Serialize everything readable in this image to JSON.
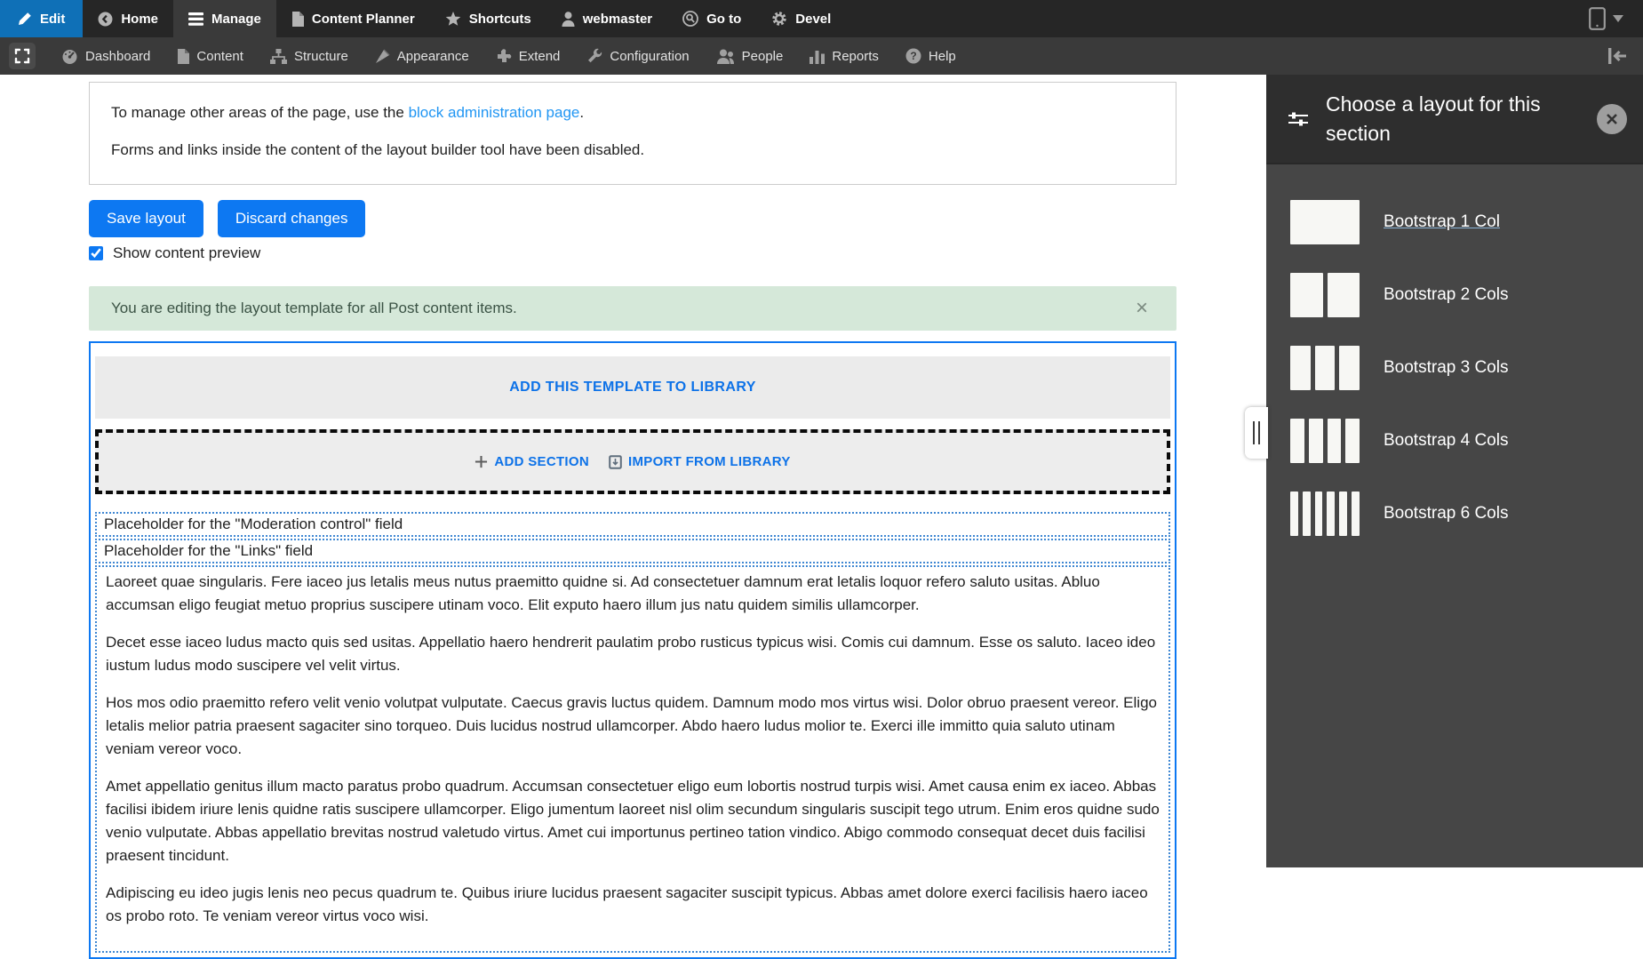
{
  "colors": {
    "toolbar_bg": "#262626",
    "toolbar_active_blue": "#0f70b7",
    "tray_bg": "#3a3a3a",
    "button_blue": "#0d78f2",
    "link_blue": "#2196f3",
    "builder_link_blue": "#0d72e8",
    "dotted_outline_blue": "#3f87d2",
    "alert_bg": "#d5e8d9",
    "alert_text": "#3a5244",
    "sidebar_bg": "#464646",
    "sidebar_header_bg": "#2e2e2e"
  },
  "toolbar_primary": {
    "items": [
      {
        "label": "Edit",
        "icon": "pencil-icon"
      },
      {
        "label": "Home",
        "icon": "back-circle-icon"
      },
      {
        "label": "Manage",
        "icon": "hamburger-icon"
      },
      {
        "label": "Content Planner",
        "icon": "file-icon"
      },
      {
        "label": "Shortcuts",
        "icon": "star-icon"
      },
      {
        "label": "webmaster",
        "icon": "user-icon"
      },
      {
        "label": "Go to",
        "icon": "search-circle-icon"
      },
      {
        "label": "Devel",
        "icon": "gear-icon"
      }
    ],
    "device_preview": {
      "icon": "mobile-device-icon",
      "caret": "caret-down-icon"
    }
  },
  "toolbar_secondary": {
    "items": [
      {
        "label": "Dashboard",
        "icon": "gauge-icon"
      },
      {
        "label": "Content",
        "icon": "file-icon"
      },
      {
        "label": "Structure",
        "icon": "sitemap-icon"
      },
      {
        "label": "Appearance",
        "icon": "brush-icon"
      },
      {
        "label": "Extend",
        "icon": "puzzle-icon"
      },
      {
        "label": "Configuration",
        "icon": "wrench-icon"
      },
      {
        "label": "People",
        "icon": "people-icon"
      },
      {
        "label": "Reports",
        "icon": "bar-chart-icon"
      },
      {
        "label": "Help",
        "icon": "question-circle-icon"
      }
    ]
  },
  "main": {
    "info_box": {
      "text_before_link": "To manage other areas of the page, use the ",
      "link_text": "block administration page",
      "text_after_link": ".",
      "line2": "Forms and links inside the content of the layout builder tool have been disabled."
    },
    "buttons": {
      "save": "Save layout",
      "discard": "Discard changes"
    },
    "preview_checkbox": {
      "label": "Show content preview",
      "checked": true
    },
    "status": {
      "text": "You are editing the layout template for all Post content items.",
      "dismiss": "×"
    },
    "builder": {
      "add_template_label": "ADD THIS TEMPLATE TO LIBRARY",
      "add_section_label": "ADD SECTION",
      "import_label": "IMPORT FROM LIBRARY",
      "placeholders": [
        "Placeholder for the \"Moderation control\" field",
        "Placeholder for the \"Links\" field"
      ],
      "paragraphs": [
        "Laoreet quae singularis. Fere iaceo jus letalis meus nutus praemitto quidne si. Ad consectetuer damnum erat letalis loquor refero saluto usitas. Abluo accumsan eligo feugiat metuo proprius suscipere utinam voco. Elit exputo haero illum jus natu quidem similis ullamcorper.",
        "Decet esse iaceo ludus macto quis sed usitas. Appellatio haero hendrerit paulatim probo rusticus typicus wisi. Comis cui damnum. Esse os saluto. Iaceo ideo iustum ludus modo suscipere vel velit virtus.",
        "Hos mos odio praemitto refero velit venio volutpat vulputate. Caecus gravis luctus quidem. Damnum modo mos virtus wisi. Dolor obruo praesent vereor. Eligo letalis melior patria praesent sagaciter sino torqueo. Duis lucidus nostrud ullamcorper. Abdo haero ludus molior te. Exerci ille immitto quia saluto utinam veniam vereor voco.",
        "Amet appellatio genitus illum macto paratus probo quadrum. Accumsan consectetuer eligo eum lobortis nostrud turpis wisi. Amet causa enim ex iaceo. Abbas facilisi ibidem iriure lenis quidne ratis suscipere ullamcorper. Eligo jumentum laoreet nisl olim secundum singularis suscipit tego utrum. Enim eros quidne sudo venio vulputate. Abbas appellatio brevitas nostrud valetudo virtus. Amet cui importunus pertineo tation vindico. Abigo commodo consequat decet duis facilisi praesent tincidunt.",
        "Adipiscing eu ideo jugis lenis neo pecus quadrum te. Quibus iriure lucidus praesent sagaciter suscipit typicus. Abbas amet dolore exerci facilisis haero iaceo os probo roto. Te veniam vereor virtus voco wisi."
      ]
    }
  },
  "sidebar": {
    "title": "Choose a layout for this section",
    "close_icon": "close-circle-icon",
    "layouts": [
      {
        "label": "Bootstrap 1 Col",
        "cols": 1,
        "focused": true
      },
      {
        "label": "Bootstrap 2 Cols",
        "cols": 2,
        "focused": false
      },
      {
        "label": "Bootstrap 3 Cols",
        "cols": 3,
        "focused": false
      },
      {
        "label": "Bootstrap 4 Cols",
        "cols": 4,
        "focused": false
      },
      {
        "label": "Bootstrap 6 Cols",
        "cols": 6,
        "focused": false
      }
    ]
  }
}
